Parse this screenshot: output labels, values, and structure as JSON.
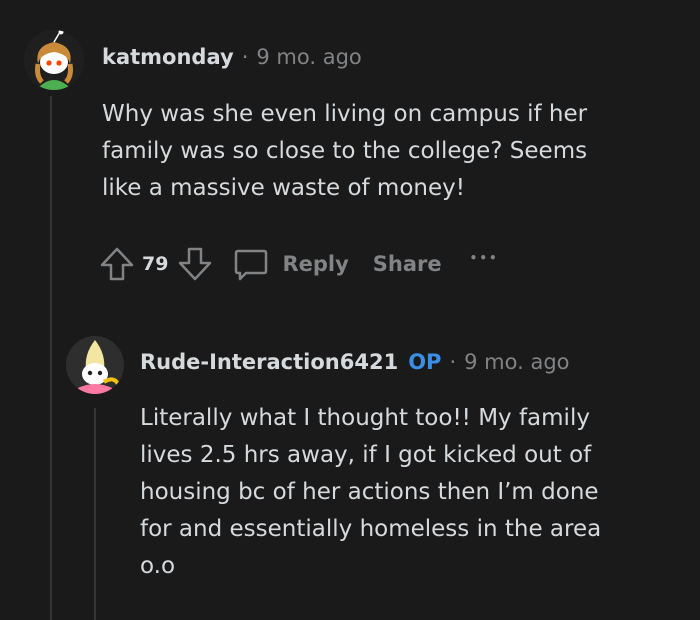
{
  "comments": [
    {
      "username": "katmonday",
      "time": "9 mo. ago",
      "body_lines": [
        "Why was she even living on campus if her",
        "family was so close to the college? Seems",
        "like a massive waste of money!"
      ],
      "score": "79",
      "reply_label": "Reply",
      "share_label": "Share",
      "more_label": "•••"
    },
    {
      "username": "Rude-Interaction6421",
      "op_badge": "OP",
      "time": "9 mo. ago",
      "body_lines": [
        "Literally what I thought too!! My family",
        "lives 2.5 hrs away, if I got kicked out of",
        "housing bc of her actions then I’m done",
        "for and essentially homeless in the area",
        "o.o"
      ]
    }
  ],
  "colors": {
    "background": "#1a1a1b",
    "text": "#d7dadc",
    "meta": "#818384",
    "op_badge": "#3a8fe4"
  },
  "icons": [
    "avatar-katmonday",
    "upvote-icon",
    "downvote-icon",
    "comment-icon",
    "more-icon",
    "avatar-banana"
  ]
}
